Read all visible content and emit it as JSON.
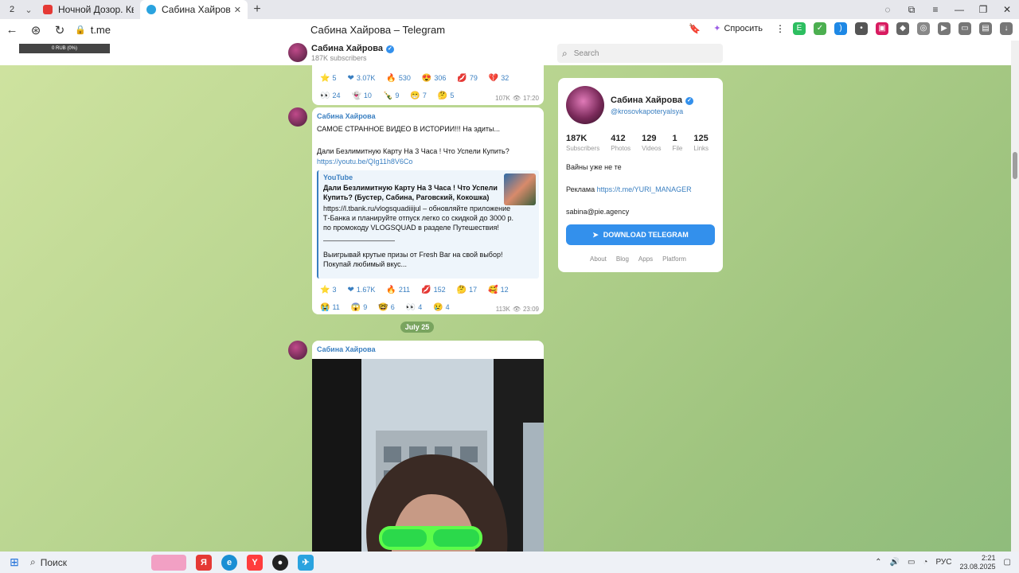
{
  "browser": {
    "tab_count": "2",
    "tabs": [
      {
        "title": "Ночной Дозор. Квест на г"
      },
      {
        "title": "Сабина Хайрова – Tele"
      }
    ],
    "url": "t.me",
    "page_title": "Сабина Хайрова – Telegram",
    "ask_label": "Спросить"
  },
  "overlay": {
    "text": "0 RUB (0%)"
  },
  "channel": {
    "name": "Сабина Хайрова",
    "subscribers": "187K subscribers",
    "search_placeholder": "Search"
  },
  "messages": [
    {
      "reactions": [
        {
          "emoji": "⭐",
          "count": "5"
        },
        {
          "emoji": "❤",
          "count": "3.07K"
        },
        {
          "emoji": "🔥",
          "count": "530"
        },
        {
          "emoji": "😍",
          "count": "306"
        },
        {
          "emoji": "💋",
          "count": "79"
        },
        {
          "emoji": "💔",
          "count": "32"
        },
        {
          "emoji": "👀",
          "count": "24"
        },
        {
          "emoji": "👻",
          "count": "10"
        },
        {
          "emoji": "🍾",
          "count": "9"
        },
        {
          "emoji": "😁",
          "count": "7"
        },
        {
          "emoji": "🤔",
          "count": "5"
        }
      ],
      "views": "107K",
      "time": "17:20"
    },
    {
      "sender": "Сабина Хайрова",
      "text1": "САМОЕ СТРАННОЕ ВИДЕО В ИСТОРИИ!!! На эдиты...",
      "text2": "Дали Безлимитную Карту На 3 Часа ! Что Успели Купить?",
      "link": "https://youtu.be/QIg11h8V6Co",
      "preview": {
        "source": "YouTube",
        "title": "Дали Безлимитную Карту На 3 Часа ! Что Успели Купить? (Бустер, Сабина, Раговский, Кокошка)",
        "desc1": "https://l.tbank.ru/vlogsquadiiijul – обновляйте приложение Т-Банка и планируйте отпуск легко со скидкой до 3000 р. по промокоду VLOGSQUAD в разделе Путешествия!",
        "divider": "——————————",
        "desc2": "Выигрывай крутые призы от Fresh Bar на свой выбор! Покупай любимый вкус..."
      },
      "reactions": [
        {
          "emoji": "⭐",
          "count": "3"
        },
        {
          "emoji": "❤",
          "count": "1.67K"
        },
        {
          "emoji": "🔥",
          "count": "211"
        },
        {
          "emoji": "💋",
          "count": "152"
        },
        {
          "emoji": "🤔",
          "count": "17"
        },
        {
          "emoji": "🥰",
          "count": "12"
        },
        {
          "emoji": "😭",
          "count": "11"
        },
        {
          "emoji": "😱",
          "count": "9"
        },
        {
          "emoji": "🤓",
          "count": "6"
        },
        {
          "emoji": "👀",
          "count": "4"
        },
        {
          "emoji": "😢",
          "count": "4"
        }
      ],
      "views": "113K",
      "time": "23:09"
    },
    {
      "sender": "Сабина Хайрова"
    }
  ],
  "date_divider": "July 25",
  "profile": {
    "name": "Сабина Хайрова",
    "handle": "@krosovkapoteryalsya",
    "stats": [
      {
        "value": "187K",
        "label": "Subscribers"
      },
      {
        "value": "412",
        "label": "Photos"
      },
      {
        "value": "129",
        "label": "Videos"
      },
      {
        "value": "1",
        "label": "File"
      },
      {
        "value": "125",
        "label": "Links"
      }
    ],
    "bio": "Вайны уже не те",
    "ads_label": "Реклама",
    "ads_link": "https://t.me/YURI_MANAGER",
    "email": "sabina@pie.agency",
    "download_label": "DOWNLOAD TELEGRAM",
    "links": [
      "About",
      "Blog",
      "Apps",
      "Platform"
    ]
  },
  "taskbar": {
    "search_label": "Поиск",
    "lang": "РУС",
    "time": "2:21",
    "date": "23.08.2025"
  },
  "colors": {
    "accent": "#3390ec",
    "link": "#3a7fc1",
    "bg_green": "#b7d48f"
  }
}
